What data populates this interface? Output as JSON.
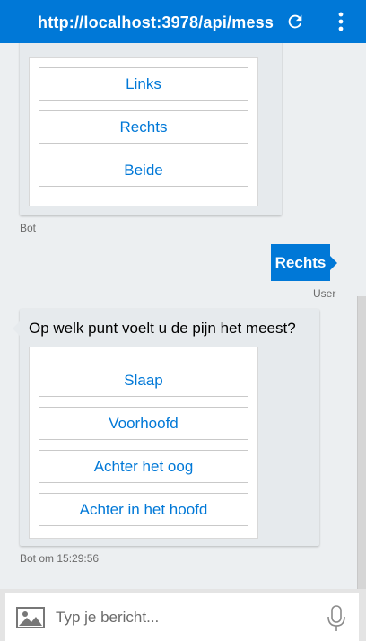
{
  "header": {
    "title": "http://localhost:3978/api/mess",
    "refresh_icon": "refresh-icon",
    "menu_icon": "more-vert-icon"
  },
  "messages": [
    {
      "from": "bot",
      "options": [
        "Links",
        "Rechts",
        "Beide"
      ],
      "meta": "Bot"
    },
    {
      "from": "user",
      "text": "Rechts",
      "meta": "User"
    },
    {
      "from": "bot",
      "text": "Op welk punt voelt u de pijn het meest?",
      "options": [
        "Slaap",
        "Voorhoofd",
        "Achter het oog",
        "Achter in het hoofd"
      ],
      "meta": "Bot om 15:29:56"
    }
  ],
  "composer": {
    "placeholder": "Typ je bericht...",
    "image_icon": "image-upload-icon",
    "mic_icon": "microphone-icon"
  },
  "colors": {
    "accent": "#0078d7",
    "background": "#eceff1"
  }
}
